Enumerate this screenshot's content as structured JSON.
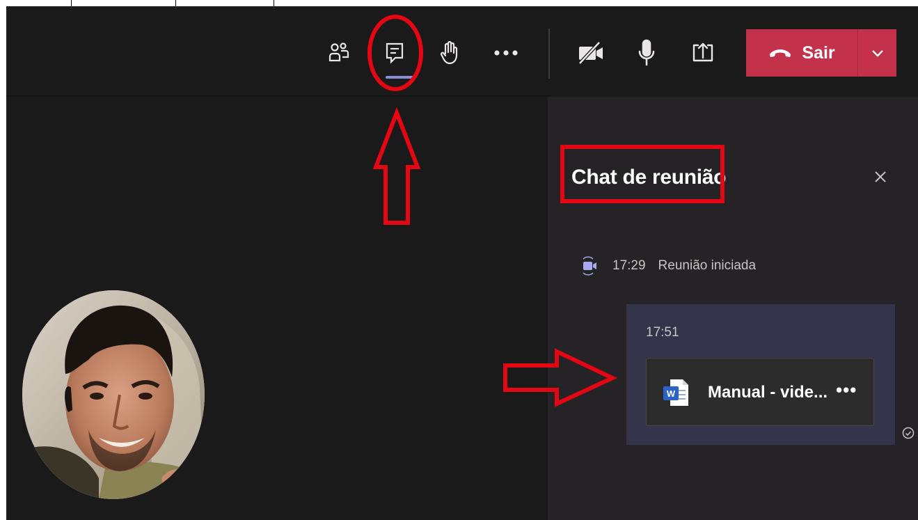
{
  "toolbar": {
    "buttons": [
      "participants-icon",
      "chat-icon",
      "raise-hand-icon",
      "more-icon",
      "camera-off-icon",
      "mic-icon",
      "share-screen-icon"
    ],
    "leave_label": "Sair",
    "leave_color": "#c4314b",
    "chat_active_indicator": "#8b8cd8"
  },
  "panel": {
    "title": "Chat de reunião",
    "events": [
      {
        "time": "17:29",
        "text": "Reunião iniciada",
        "icon": "meeting-camera-icon"
      }
    ],
    "message": {
      "time": "17:51",
      "file": {
        "name": "Manual - vide...",
        "icon": "word-doc-icon",
        "more": "•••"
      }
    }
  },
  "annotations": {
    "color": "#e30613",
    "shapes": [
      "circle-around-chat-button",
      "arrow-up-to-chat-button",
      "box-around-panel-title",
      "arrow-right-to-file-message"
    ]
  }
}
